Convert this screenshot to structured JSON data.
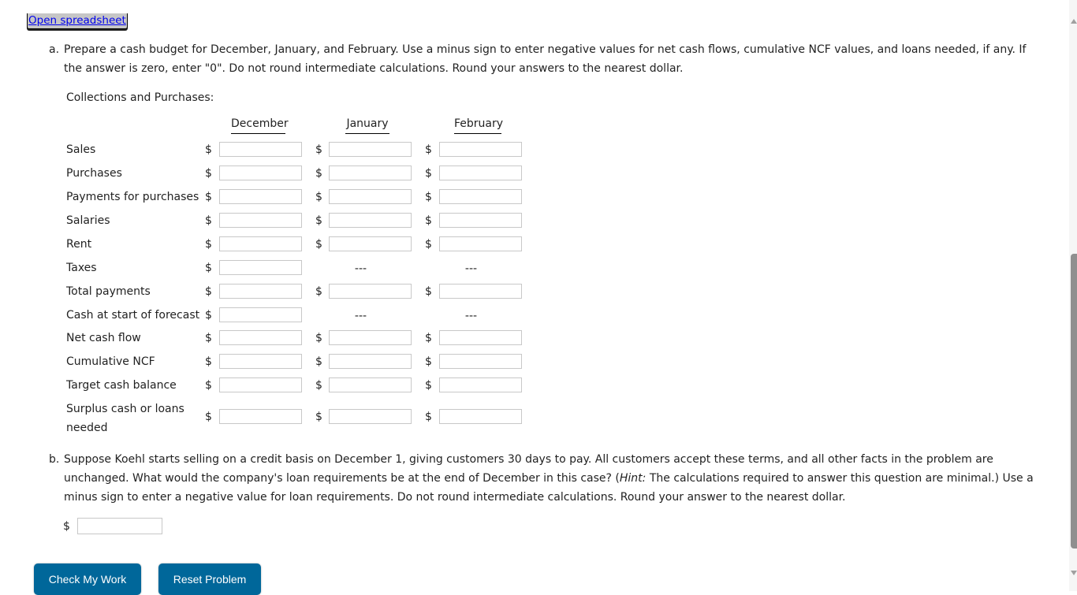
{
  "links": {
    "open_spreadsheet": "Open spreadsheet"
  },
  "part_a": {
    "letter": "a.",
    "instructions": "Prepare a cash budget for December, January, and February. Use a minus sign to enter negative values for net cash flows, cumulative NCF values, and loans needed, if any. If the answer is zero, enter \"0\". Do not round intermediate calculations. Round your answers to the nearest dollar.",
    "section_label": "Collections and Purchases:",
    "columns": [
      "December",
      "January",
      "February"
    ],
    "currency_symbol": "$",
    "dash_placeholder": "---",
    "rows": [
      {
        "label": "Sales",
        "cells": [
          "input",
          "input",
          "input"
        ]
      },
      {
        "label": "Purchases",
        "cells": [
          "input",
          "input",
          "input"
        ]
      },
      {
        "label": "Payments for purchases",
        "cells": [
          "input",
          "input",
          "input"
        ]
      },
      {
        "label": "Salaries",
        "cells": [
          "input",
          "input",
          "input"
        ]
      },
      {
        "label": "Rent",
        "cells": [
          "input",
          "input",
          "input"
        ]
      },
      {
        "label": "Taxes",
        "cells": [
          "input",
          "dash",
          "dash"
        ]
      },
      {
        "label": "Total payments",
        "cells": [
          "input",
          "input",
          "input"
        ]
      },
      {
        "label": "Cash at start of forecast",
        "cells": [
          "input",
          "dash",
          "dash"
        ]
      },
      {
        "label": "Net cash flow",
        "cells": [
          "input",
          "input",
          "input"
        ]
      },
      {
        "label": "Cumulative NCF",
        "cells": [
          "input",
          "input",
          "input"
        ]
      },
      {
        "label": "Target cash balance",
        "cells": [
          "input",
          "input",
          "input"
        ]
      },
      {
        "label": "Surplus cash or loans needed",
        "cells": [
          "input",
          "input",
          "input"
        ]
      }
    ],
    "values": [
      [
        "",
        "",
        ""
      ],
      [
        "",
        "",
        ""
      ],
      [
        "",
        "",
        ""
      ],
      [
        "",
        "",
        ""
      ],
      [
        "",
        "",
        ""
      ],
      [
        "",
        "",
        ""
      ],
      [
        "",
        "",
        ""
      ],
      [
        "",
        "",
        ""
      ],
      [
        "",
        "",
        ""
      ],
      [
        "",
        "",
        ""
      ],
      [
        "",
        "",
        ""
      ],
      [
        "",
        "",
        ""
      ]
    ]
  },
  "part_b": {
    "letter": "b.",
    "text_1": "Suppose Koehl starts selling on a credit basis on December 1, giving customers 30 days to pay. All customers accept these terms, and all other facts in the problem are unchanged. What would the company's loan requirements be at the end of December in this case? (",
    "hint_label": "Hint:",
    "text_2": " The calculations required to answer this question are minimal.) Use a minus sign to enter a negative value for loan requirements. Do not round intermediate calculations. Round your answer to the nearest dollar.",
    "currency_symbol": "$",
    "answer_value": ""
  },
  "buttons": {
    "check_my_work": "Check My Work",
    "reset_problem": "Reset Problem"
  },
  "colors": {
    "button_bg": "#00679a",
    "link": "#0000ee",
    "input_border": "#c8c8c8"
  }
}
